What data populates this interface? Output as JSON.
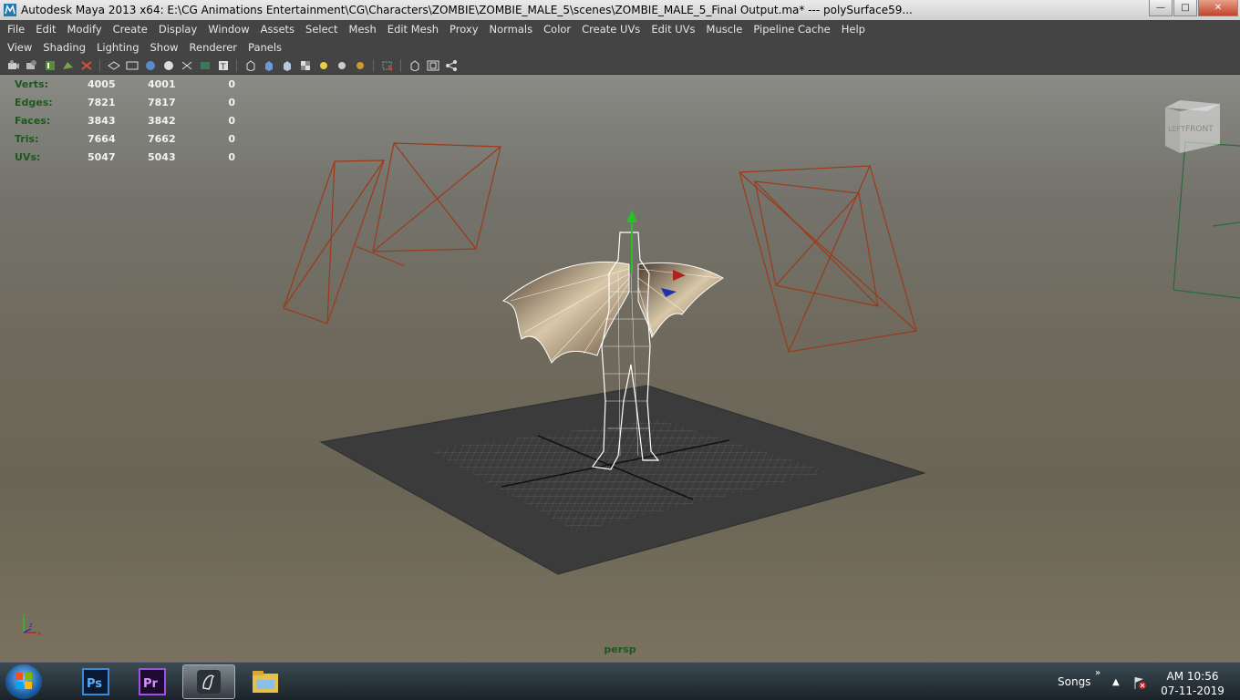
{
  "window": {
    "title": "Autodesk Maya 2013 x64: E:\\CG Animations Entertainment\\CG\\Characters\\ZOMBIE\\ZOMBIE_MALE_5\\scenes\\ZOMBIE_MALE_5_Final Output.ma*   ---   polySurface59..."
  },
  "menubar": [
    "File",
    "Edit",
    "Modify",
    "Create",
    "Display",
    "Window",
    "Assets",
    "Select",
    "Mesh",
    "Edit Mesh",
    "Proxy",
    "Normals",
    "Color",
    "Create UVs",
    "Edit UVs",
    "Muscle",
    "Pipeline Cache",
    "Help"
  ],
  "panel_menu": [
    "View",
    "Shading",
    "Lighting",
    "Show",
    "Renderer",
    "Panels"
  ],
  "toolbar_icons": [
    "camera-icon",
    "camera-attributes-icon",
    "bookmark-icon",
    "image-plane-icon",
    "grid-icon",
    "wireframe-icon",
    "smooth-shade-icon",
    "default-material-icon",
    "xray-icon",
    "wireframe-on-shaded-icon",
    "textured-icon",
    "use-all-lights-icon",
    "shadows-icon",
    "isolate-select-icon",
    "resolution-gate-icon",
    "field-chart-icon",
    "film-gate-icon"
  ],
  "hud": {
    "rows": [
      {
        "label": "Verts:",
        "v1": "4005",
        "v2": "4001",
        "v3": "0"
      },
      {
        "label": "Edges:",
        "v1": "7821",
        "v2": "7817",
        "v3": "0"
      },
      {
        "label": "Faces:",
        "v1": "3843",
        "v2": "3842",
        "v3": "0"
      },
      {
        "label": "Tris:",
        "v1": "7664",
        "v2": "7662",
        "v3": "0"
      },
      {
        "label": "UVs:",
        "v1": "5047",
        "v2": "5043",
        "v3": "0"
      }
    ]
  },
  "viewport": {
    "camera_label": "persp",
    "viewcube": {
      "left": "LEFT",
      "front": "FRONT"
    },
    "axis": {
      "y": "y",
      "x": "x",
      "z": "z"
    }
  },
  "taskbar": {
    "apps": [
      "windows-start-icon",
      "photoshop-icon",
      "premiere-icon",
      "maya-icon",
      "file-explorer-icon"
    ],
    "ps_label": "Ps",
    "pr_label": "Pr",
    "toolbar_name": "Songs",
    "toolbar_chevron": "»",
    "clock_time": "AM 10:56",
    "clock_date": "07-11-2019"
  },
  "colors": {
    "hud_label": "#1c5a1c",
    "light_frame": "#9c3a1a",
    "camera_frame": "#2a6a3a"
  }
}
